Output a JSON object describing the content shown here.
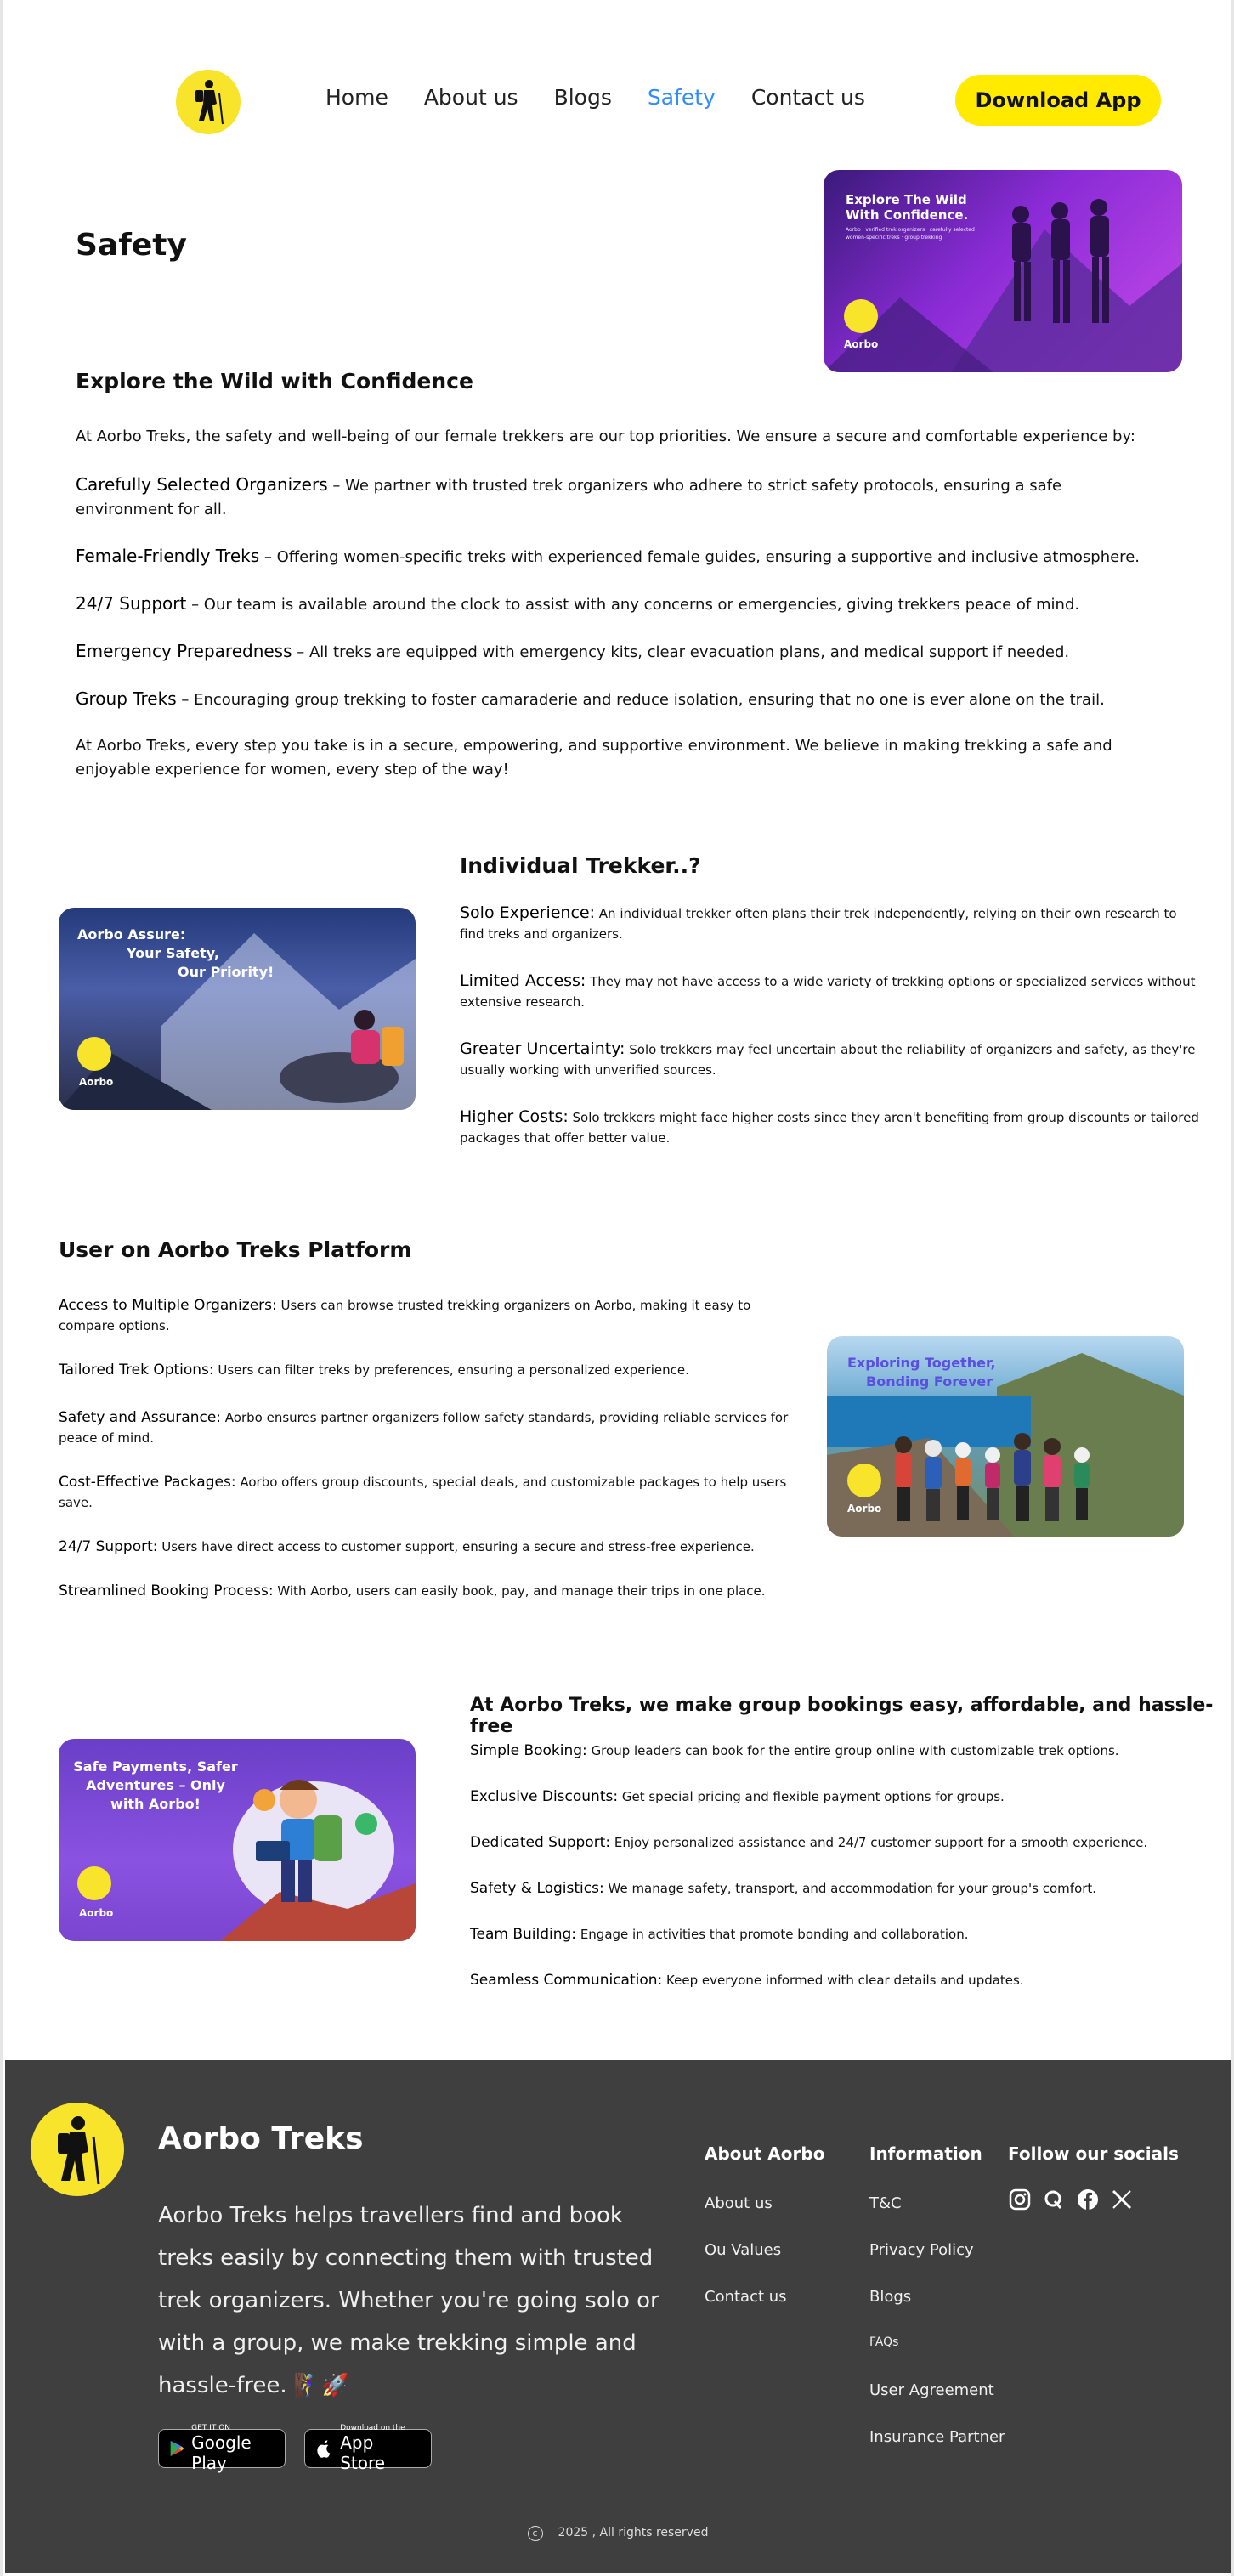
{
  "nav": {
    "items": [
      "Home",
      "About us",
      "Blogs",
      "Safety",
      "Contact us"
    ],
    "active": "Safety",
    "download_label": "Download App"
  },
  "safety": {
    "title": "Safety",
    "hero_card": {
      "heading": "Explore The Wild\nWith Confidence.",
      "subtext": "Aorbo · verified trek organizers · carefully selected · women-specific treks · group trekking",
      "brand": "Aorbo"
    },
    "subtitle": "Explore the Wild with Confidence",
    "intro": "At Aorbo Treks, the safety and well-being of our female trekkers are our top priorities. We ensure a secure and comfortable experience by:",
    "points": [
      {
        "title": "Carefully Selected Organizers",
        "sep": " – ",
        "text": "We partner with trusted trek organizers who adhere to strict safety protocols, ensuring a safe environment for all."
      },
      {
        "title": "Female-Friendly Treks",
        "sep": " – ",
        "text": "Offering women-specific treks with experienced female guides, ensuring a supportive and inclusive atmosphere."
      },
      {
        "title": "24/7 Support",
        "sep": " – ",
        "text": "Our team is available around the clock to assist with any concerns or emergencies, giving trekkers peace of mind."
      },
      {
        "title": "Emergency Preparedness",
        "sep": " – ",
        "text": "All treks are equipped with emergency kits, clear evacuation plans, and medical support if needed."
      },
      {
        "title": "Group Treks",
        "sep": " – ",
        "text": "Encouraging group trekking to foster camaraderie and reduce isolation, ensuring that no one is ever alone on the trail."
      }
    ],
    "closing": "At Aorbo Treks, every step you take is in a secure, empowering, and supportive environment. We believe in making trekking a safe and enjoyable experience for women, every step of the way!"
  },
  "individual": {
    "title": "Individual Trekker..?",
    "card": {
      "heading1": "Aorbo Assure:",
      "heading2": "Your Safety,",
      "heading3": "Our Priority!",
      "brand": "Aorbo"
    },
    "points": [
      {
        "title": "Solo Experience:",
        "text": "An individual trekker often plans their trek independently, relying on their own research to find treks and organizers."
      },
      {
        "title": "Limited Access:",
        "text": "They may not have access to a wide variety of trekking options or specialized services without extensive research."
      },
      {
        "title": "Greater Uncertainty:",
        "text": "Solo trekkers may feel uncertain about the reliability of organizers and safety, as they're usually working with unverified sources."
      },
      {
        "title": "Higher Costs:",
        "text": "Solo trekkers might face higher costs since they aren't benefiting from group discounts or tailored packages that offer better value."
      }
    ]
  },
  "platform": {
    "title": "User on Aorbo Treks Platform",
    "card": {
      "heading1": "Exploring Together,",
      "heading2": "Bonding Forever",
      "brand": "Aorbo"
    },
    "points": [
      {
        "title": "Access to Multiple Organizers:",
        "text": "Users can browse trusted trekking organizers on Aorbo, making it easy to compare options."
      },
      {
        "title": "Tailored Trek Options:",
        "text": "Users can filter treks by preferences, ensuring a personalized experience."
      },
      {
        "title": "Safety and Assurance:",
        "text": "Aorbo ensures partner organizers follow safety standards, providing reliable services for peace of mind."
      },
      {
        "title": "Cost-Effective Packages:",
        "text": "Aorbo offers group discounts, special deals, and customizable packages to help users save."
      },
      {
        "title": "24/7 Support:",
        "text": "Users have direct access to customer support, ensuring a secure and stress-free experience."
      },
      {
        "title": "Streamlined Booking Process:",
        "text": "With Aorbo, users can easily book, pay, and manage their trips in one place."
      }
    ]
  },
  "group": {
    "title": "At Aorbo Treks, we make group bookings easy, affordable, and hassle-free",
    "card": {
      "heading": "Safe Payments, Safer Adventures – Only with Aorbo!",
      "brand": "Aorbo"
    },
    "points": [
      {
        "title": "Simple Booking:",
        "text": "Group leaders can book for the entire group online with customizable trek options."
      },
      {
        "title": "Exclusive Discounts:",
        "text": "Get special pricing and flexible payment options for groups."
      },
      {
        "title": "Dedicated Support:",
        "text": "Enjoy personalized assistance and 24/7 customer support for a smooth experience."
      },
      {
        "title": "Safety & Logistics:",
        "text": "We manage safety, transport, and accommodation for your group's comfort."
      },
      {
        "title": "Team Building:",
        "text": "Engage in activities that promote bonding and collaboration."
      },
      {
        "title": "Seamless Communication:",
        "text": "Keep everyone informed with clear details and updates."
      }
    ]
  },
  "footer": {
    "brand": "Aorbo Treks",
    "description": "Aorbo Treks helps travellers find and book treks easily by connecting them with trusted trek organizers. Whether you're going solo or with a group, we make trekking simple and hassle-free. 🧗‍♀️🚀",
    "google_play": {
      "small": "GET IT ON",
      "big": "Google Play"
    },
    "app_store": {
      "small": "Download on the",
      "big": "App Store"
    },
    "about_title": "About  Aorbo",
    "about_links": [
      "About us",
      "Ou Values",
      "Contact us"
    ],
    "info_title": "Information",
    "info_links": [
      "T&C",
      "Privacy Policy",
      "Blogs",
      "FAQs",
      "User Agreement",
      "Insurance Partner"
    ],
    "social_title": "Follow our socials",
    "socials": [
      "instagram-icon",
      "quora-icon",
      "facebook-icon",
      "x-icon"
    ],
    "copyright": "2025 , All rights reserved"
  }
}
